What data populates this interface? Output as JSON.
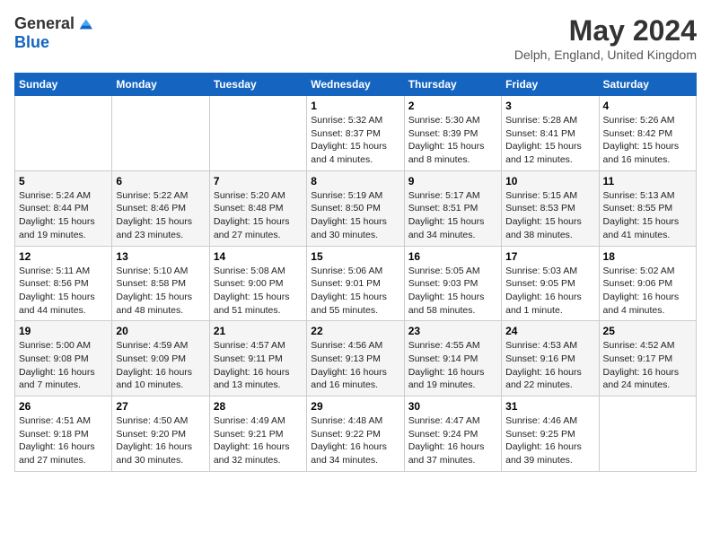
{
  "header": {
    "logo_general": "General",
    "logo_blue": "Blue",
    "month": "May 2024",
    "location": "Delph, England, United Kingdom"
  },
  "days_of_week": [
    "Sunday",
    "Monday",
    "Tuesday",
    "Wednesday",
    "Thursday",
    "Friday",
    "Saturday"
  ],
  "weeks": [
    [
      {
        "day": "",
        "info": ""
      },
      {
        "day": "",
        "info": ""
      },
      {
        "day": "",
        "info": ""
      },
      {
        "day": "1",
        "info": "Sunrise: 5:32 AM\nSunset: 8:37 PM\nDaylight: 15 hours\nand 4 minutes."
      },
      {
        "day": "2",
        "info": "Sunrise: 5:30 AM\nSunset: 8:39 PM\nDaylight: 15 hours\nand 8 minutes."
      },
      {
        "day": "3",
        "info": "Sunrise: 5:28 AM\nSunset: 8:41 PM\nDaylight: 15 hours\nand 12 minutes."
      },
      {
        "day": "4",
        "info": "Sunrise: 5:26 AM\nSunset: 8:42 PM\nDaylight: 15 hours\nand 16 minutes."
      }
    ],
    [
      {
        "day": "5",
        "info": "Sunrise: 5:24 AM\nSunset: 8:44 PM\nDaylight: 15 hours\nand 19 minutes."
      },
      {
        "day": "6",
        "info": "Sunrise: 5:22 AM\nSunset: 8:46 PM\nDaylight: 15 hours\nand 23 minutes."
      },
      {
        "day": "7",
        "info": "Sunrise: 5:20 AM\nSunset: 8:48 PM\nDaylight: 15 hours\nand 27 minutes."
      },
      {
        "day": "8",
        "info": "Sunrise: 5:19 AM\nSunset: 8:50 PM\nDaylight: 15 hours\nand 30 minutes."
      },
      {
        "day": "9",
        "info": "Sunrise: 5:17 AM\nSunset: 8:51 PM\nDaylight: 15 hours\nand 34 minutes."
      },
      {
        "day": "10",
        "info": "Sunrise: 5:15 AM\nSunset: 8:53 PM\nDaylight: 15 hours\nand 38 minutes."
      },
      {
        "day": "11",
        "info": "Sunrise: 5:13 AM\nSunset: 8:55 PM\nDaylight: 15 hours\nand 41 minutes."
      }
    ],
    [
      {
        "day": "12",
        "info": "Sunrise: 5:11 AM\nSunset: 8:56 PM\nDaylight: 15 hours\nand 44 minutes."
      },
      {
        "day": "13",
        "info": "Sunrise: 5:10 AM\nSunset: 8:58 PM\nDaylight: 15 hours\nand 48 minutes."
      },
      {
        "day": "14",
        "info": "Sunrise: 5:08 AM\nSunset: 9:00 PM\nDaylight: 15 hours\nand 51 minutes."
      },
      {
        "day": "15",
        "info": "Sunrise: 5:06 AM\nSunset: 9:01 PM\nDaylight: 15 hours\nand 55 minutes."
      },
      {
        "day": "16",
        "info": "Sunrise: 5:05 AM\nSunset: 9:03 PM\nDaylight: 15 hours\nand 58 minutes."
      },
      {
        "day": "17",
        "info": "Sunrise: 5:03 AM\nSunset: 9:05 PM\nDaylight: 16 hours\nand 1 minute."
      },
      {
        "day": "18",
        "info": "Sunrise: 5:02 AM\nSunset: 9:06 PM\nDaylight: 16 hours\nand 4 minutes."
      }
    ],
    [
      {
        "day": "19",
        "info": "Sunrise: 5:00 AM\nSunset: 9:08 PM\nDaylight: 16 hours\nand 7 minutes."
      },
      {
        "day": "20",
        "info": "Sunrise: 4:59 AM\nSunset: 9:09 PM\nDaylight: 16 hours\nand 10 minutes."
      },
      {
        "day": "21",
        "info": "Sunrise: 4:57 AM\nSunset: 9:11 PM\nDaylight: 16 hours\nand 13 minutes."
      },
      {
        "day": "22",
        "info": "Sunrise: 4:56 AM\nSunset: 9:13 PM\nDaylight: 16 hours\nand 16 minutes."
      },
      {
        "day": "23",
        "info": "Sunrise: 4:55 AM\nSunset: 9:14 PM\nDaylight: 16 hours\nand 19 minutes."
      },
      {
        "day": "24",
        "info": "Sunrise: 4:53 AM\nSunset: 9:16 PM\nDaylight: 16 hours\nand 22 minutes."
      },
      {
        "day": "25",
        "info": "Sunrise: 4:52 AM\nSunset: 9:17 PM\nDaylight: 16 hours\nand 24 minutes."
      }
    ],
    [
      {
        "day": "26",
        "info": "Sunrise: 4:51 AM\nSunset: 9:18 PM\nDaylight: 16 hours\nand 27 minutes."
      },
      {
        "day": "27",
        "info": "Sunrise: 4:50 AM\nSunset: 9:20 PM\nDaylight: 16 hours\nand 30 minutes."
      },
      {
        "day": "28",
        "info": "Sunrise: 4:49 AM\nSunset: 9:21 PM\nDaylight: 16 hours\nand 32 minutes."
      },
      {
        "day": "29",
        "info": "Sunrise: 4:48 AM\nSunset: 9:22 PM\nDaylight: 16 hours\nand 34 minutes."
      },
      {
        "day": "30",
        "info": "Sunrise: 4:47 AM\nSunset: 9:24 PM\nDaylight: 16 hours\nand 37 minutes."
      },
      {
        "day": "31",
        "info": "Sunrise: 4:46 AM\nSunset: 9:25 PM\nDaylight: 16 hours\nand 39 minutes."
      },
      {
        "day": "",
        "info": ""
      }
    ]
  ]
}
